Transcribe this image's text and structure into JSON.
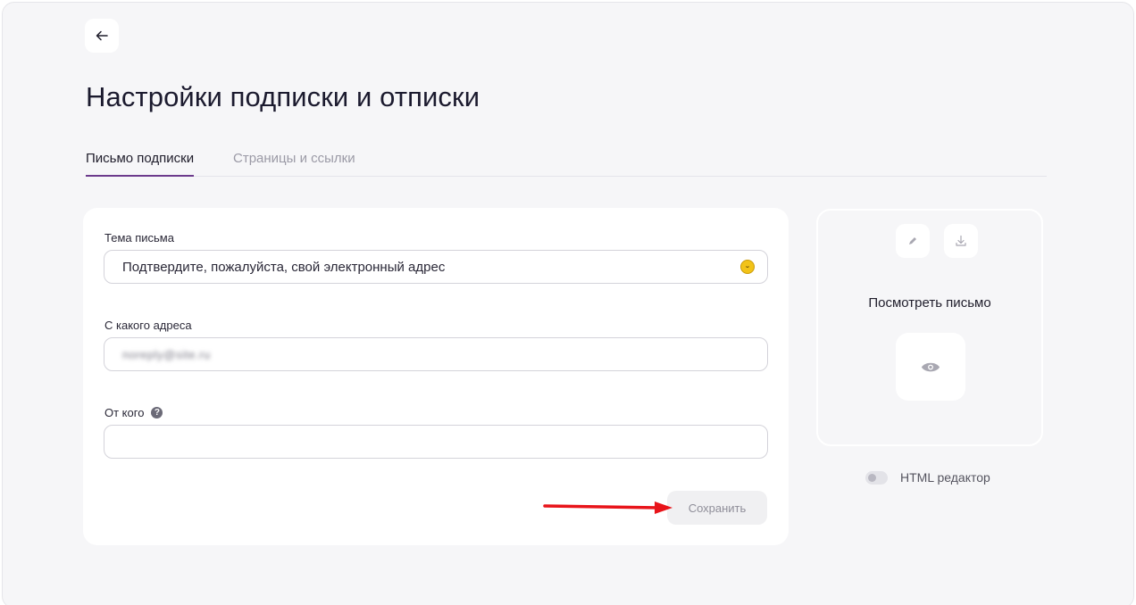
{
  "page": {
    "title": "Настройки подписки и отписки"
  },
  "header": {
    "back_icon": "arrow-left-icon"
  },
  "tabs": [
    {
      "label": "Письмо подписки",
      "active": true
    },
    {
      "label": "Страницы и ссылки",
      "active": false
    }
  ],
  "form": {
    "subject_label": "Тема письма",
    "subject_value": "Подтвердите, пожалуйста, свой электронный адрес",
    "subject_emoji_icon": "smiley-icon",
    "from_address_label": "С какого адреса",
    "from_address_value": "noreply@site.ru",
    "from_name_label": "От кого",
    "from_name_help_icon": "question-circle-icon",
    "from_name_value": "",
    "save_label": "Сохранить"
  },
  "preview": {
    "edit_icon": "pencil-icon",
    "download_icon": "download-icon",
    "title": "Посмотреть письмо",
    "view_icon": "eye-icon"
  },
  "html_editor": {
    "label": "HTML редактор",
    "enabled": false
  },
  "colors": {
    "accent": "#6c3a8c",
    "annotation_arrow": "#e8141a",
    "background": "#f6f6f8"
  }
}
